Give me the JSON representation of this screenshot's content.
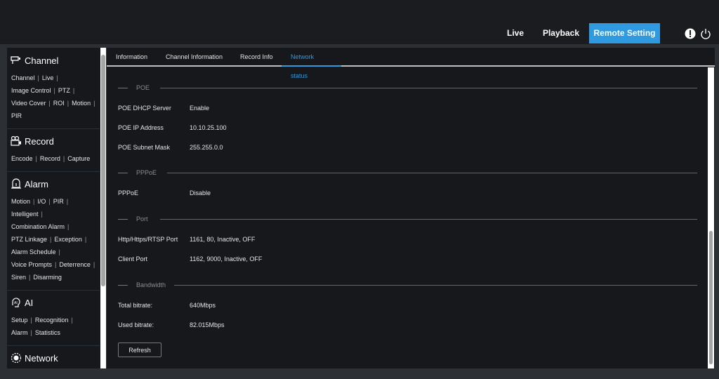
{
  "topnav": {
    "items": [
      {
        "label": "Live"
      },
      {
        "label": "Playback"
      },
      {
        "label": "Remote Setting"
      }
    ],
    "active": "Remote Setting",
    "accent": "#2f9ae0"
  },
  "sidebar": {
    "sections": [
      {
        "title": "Channel",
        "icon": "camera-icon",
        "links": [
          "Channel",
          "Live",
          "Image Control",
          "PTZ",
          "Video Cover",
          "ROI",
          "Motion",
          "PIR"
        ]
      },
      {
        "title": "Record",
        "icon": "record-icon",
        "links": [
          "Encode",
          "Record",
          "Capture"
        ]
      },
      {
        "title": "Alarm",
        "icon": "alarm-icon",
        "links": [
          "Motion",
          "I/O",
          "PIR",
          "Intelligent",
          "Combination Alarm",
          "PTZ Linkage",
          "Exception",
          "Alarm Schedule",
          "Voice Prompts",
          "Deterrence",
          "Siren",
          "Disarming"
        ]
      },
      {
        "title": "AI",
        "icon": "ai-icon",
        "links": [
          "Setup",
          "Recognition",
          "Alarm",
          "Statistics"
        ]
      },
      {
        "title": "Network",
        "icon": "network-icon",
        "links": []
      }
    ]
  },
  "tabs": [
    {
      "label": "Information"
    },
    {
      "label": "Channel Information"
    },
    {
      "label": "Record Info"
    },
    {
      "label": "Network status"
    }
  ],
  "content": {
    "sections": [
      {
        "title": "POE",
        "rows": [
          {
            "k": "POE DHCP Server",
            "v": "Enable"
          },
          {
            "k": "POE IP Address",
            "v": "10.10.25.100"
          },
          {
            "k": "POE Subnet Mask",
            "v": "255.255.0.0"
          }
        ]
      },
      {
        "title": "PPPoE",
        "rows": [
          {
            "k": "PPPoE",
            "v": "Disable"
          }
        ]
      },
      {
        "title": "Port",
        "rows": [
          {
            "k": "Http/Https/RTSP Port",
            "v": "1161, 80, Inactive, OFF"
          },
          {
            "k": "Client Port",
            "v": "1162, 9000, Inactive, OFF"
          }
        ]
      },
      {
        "title": "Bandwidth",
        "rows": [
          {
            "k": "Total bitrate:",
            "v": "640Mbps"
          },
          {
            "k": "Used bitrate:",
            "v": "82.015Mbps"
          }
        ]
      }
    ],
    "refresh_label": "Refresh"
  }
}
